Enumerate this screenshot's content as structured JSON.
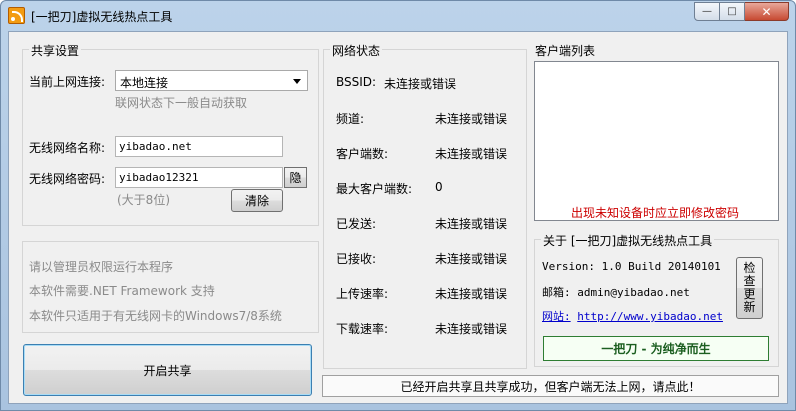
{
  "window": {
    "title": "[一把刀]虚拟无线热点工具",
    "icon": "rss-feed-icon",
    "controls": {
      "minimize": "—",
      "maximize": "□",
      "close": "✕"
    }
  },
  "share_settings": {
    "title": "共享设置",
    "connection_label": "当前上网连接:",
    "connection_value": "本地连接",
    "connection_hint": "联网状态下一般自动获取",
    "ssid_label": "无线网络名称:",
    "ssid_value": "yibadao.net",
    "password_label": "无线网络密码:",
    "password_value": "yibadao12321",
    "password_hint": "(大于8位)",
    "hide_button": "隐",
    "clear_button": "清除"
  },
  "notes": {
    "line1": "请以管理员权限运行本程序",
    "line2": "本软件需要.NET Framework 支持",
    "line3": "本软件只适用于有无线网卡的Windows7/8系统"
  },
  "start_button": "开启共享",
  "network_status": {
    "title": "网络状态",
    "rows": [
      {
        "label": "BSSID:",
        "value": "未连接或错误"
      },
      {
        "label": "频道:",
        "value": "未连接或错误"
      },
      {
        "label": "客户端数:",
        "value": "未连接或错误"
      },
      {
        "label": "最大客户端数:",
        "value": "0"
      },
      {
        "label": "已发送:",
        "value": "未连接或错误"
      },
      {
        "label": "已接收:",
        "value": "未连接或错误"
      },
      {
        "label": "上传速率:",
        "value": "未连接或错误"
      },
      {
        "label": "下载速率:",
        "value": "未连接或错误"
      }
    ]
  },
  "clients": {
    "title": "客户端列表",
    "warning": "出现未知设备时应立即修改密码"
  },
  "about": {
    "title": "关于 [一把刀]虚拟无线热点工具",
    "version": "Version: 1.0   Build 20140101",
    "email": "邮箱: admin@yibadao.net",
    "website_label": "网站:",
    "website_url": "http://www.yibadao.net",
    "check_update": [
      "检",
      "查",
      "更",
      "新"
    ],
    "slogan": "一把刀 - 为纯净而生"
  },
  "status_message": "已经开启共享且共享成功，但客户端无法上网，请点此！"
}
